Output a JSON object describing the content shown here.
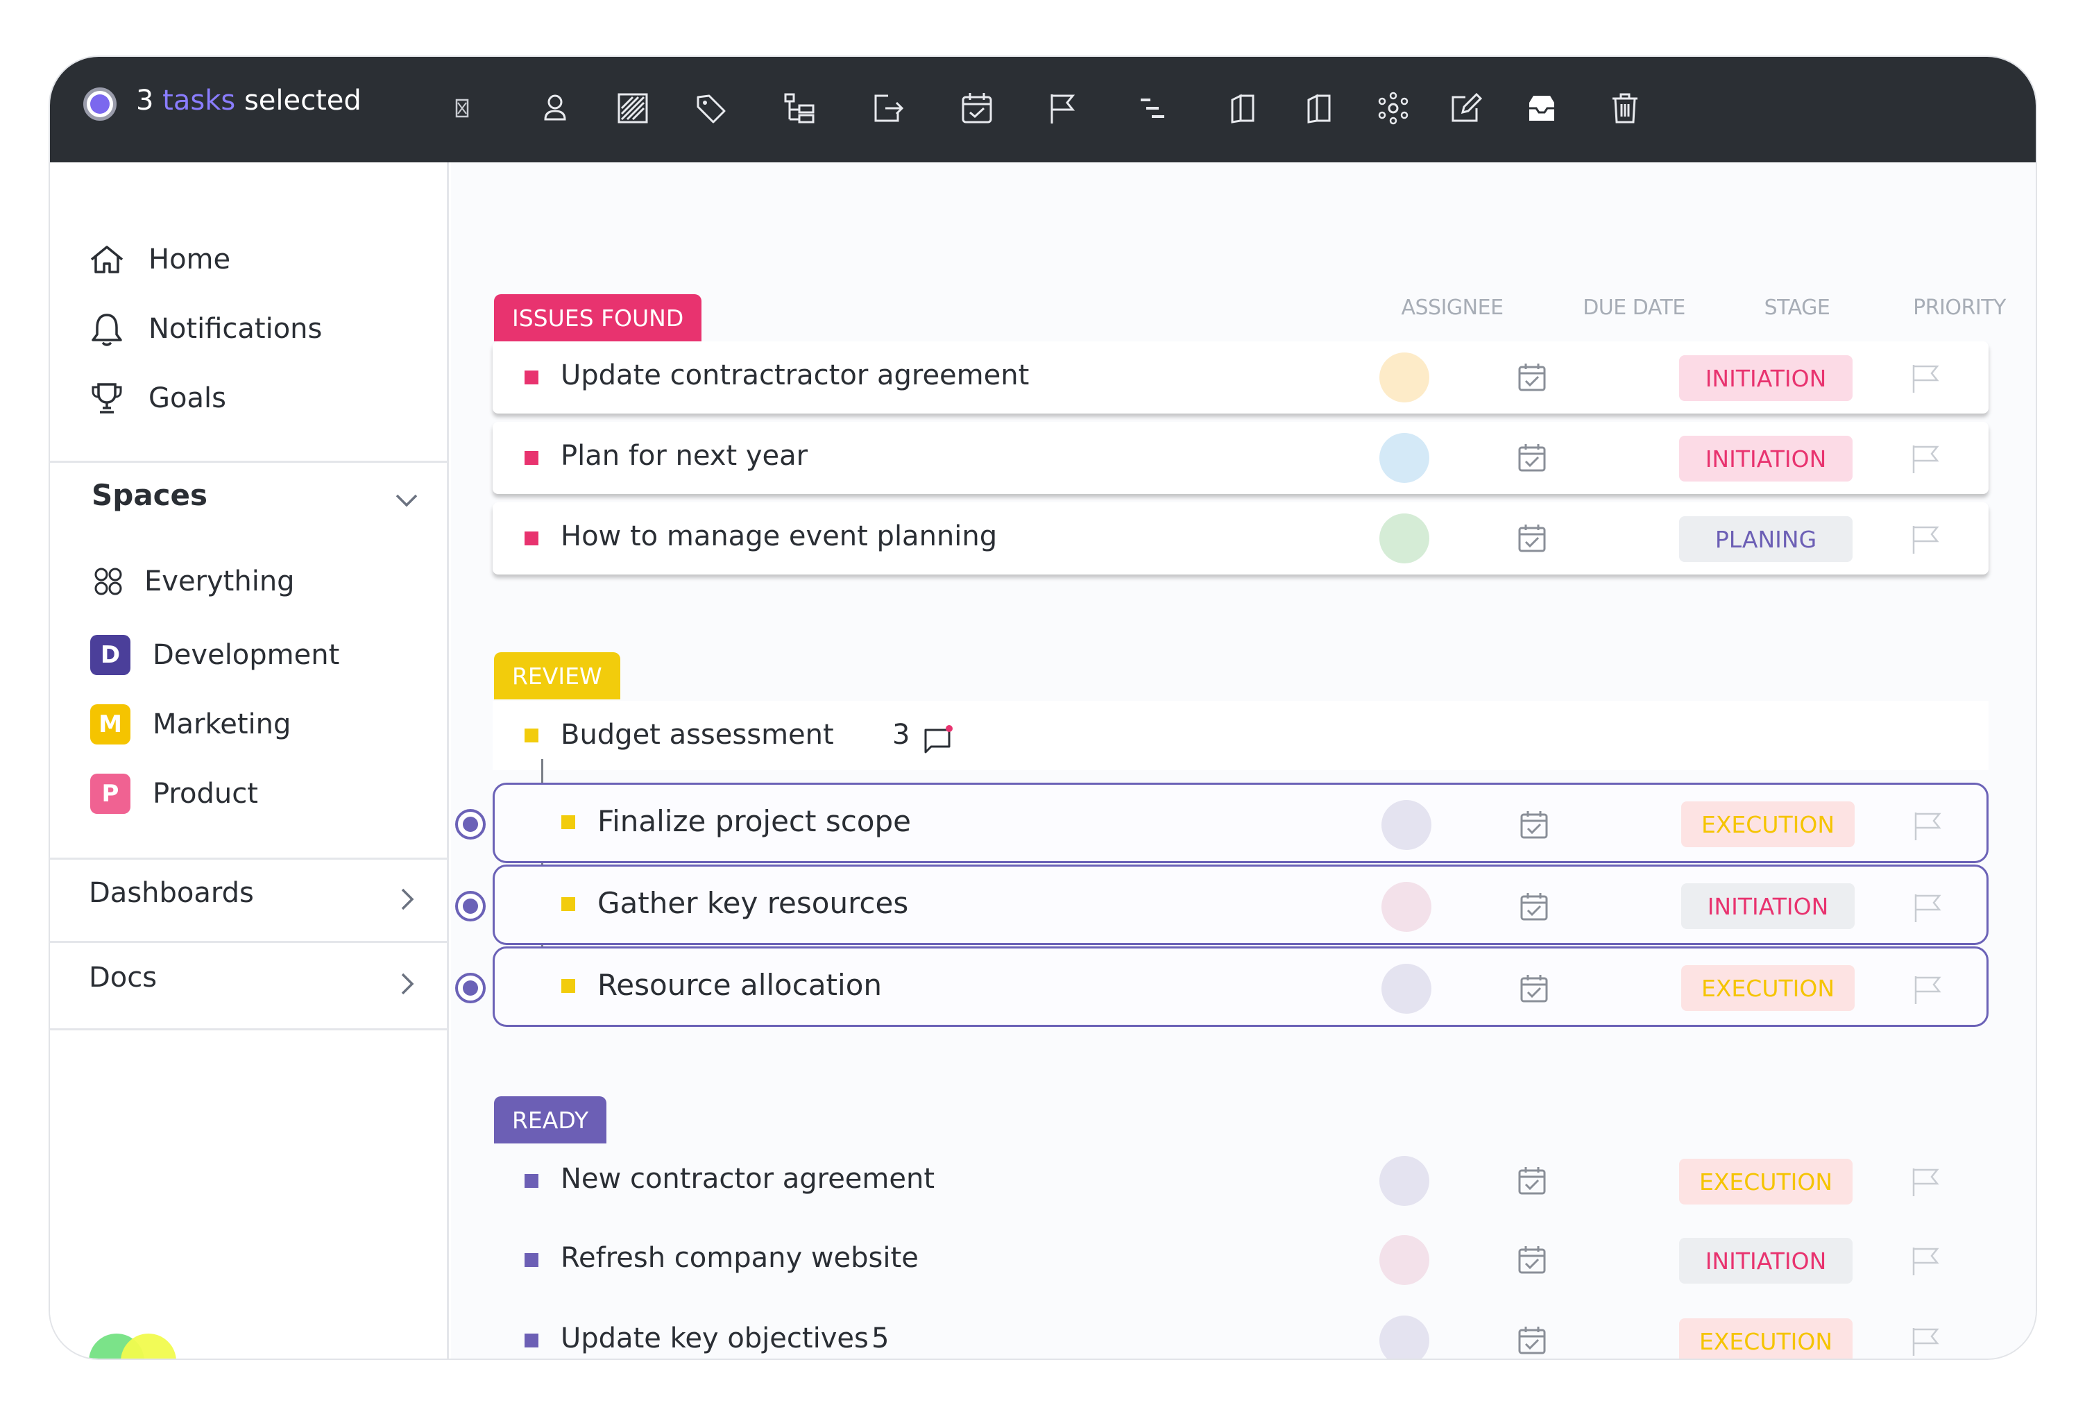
{
  "toolbar": {
    "selected_count": "3",
    "selected_word": "tasks",
    "selected_suffix": "selected",
    "icons": [
      "close-icon",
      "assignee-icon",
      "status-icon",
      "tag-icon",
      "subtask-icon",
      "move-icon",
      "due-date-icon",
      "priority-icon",
      "gantt-icon",
      "copy-icon",
      "duplicate-icon",
      "dependencies-icon",
      "edit-icon",
      "archive-icon",
      "delete-icon"
    ]
  },
  "sidebar": {
    "nav": [
      {
        "label": "Home",
        "icon": "home-icon"
      },
      {
        "label": "Notifications",
        "icon": "bell-icon"
      },
      {
        "label": "Goals",
        "icon": "trophy-icon"
      }
    ],
    "spaces_title": "Spaces",
    "spaces": [
      {
        "label": "Everything",
        "icon": "grid-icon"
      },
      {
        "label": "Development",
        "badge": "D",
        "color": "#4b3f9a"
      },
      {
        "label": "Marketing",
        "badge": "M",
        "color": "#f5c400"
      },
      {
        "label": "Product",
        "badge": "P",
        "color": "#f06292"
      }
    ],
    "dashboards": "Dashboards",
    "docs": "Docs"
  },
  "columns": {
    "assignee": "ASSIGNEE",
    "due_date": "DUE DATE",
    "stage": "STAGE",
    "priority": "PRIORITY"
  },
  "groups": [
    {
      "name": "ISSUES FOUND",
      "color": "#e8336f",
      "tasks": [
        {
          "name": "Update contractractor agreement",
          "stage": "INITIATION",
          "avatar": "#fdebc8"
        },
        {
          "name": "Plan for next year",
          "stage": "INITIATION",
          "avatar": "#d4e9f7"
        },
        {
          "name": "How to manage event planning",
          "stage": "PLANING",
          "avatar": "#d5ecd6"
        }
      ]
    },
    {
      "name": "REVIEW",
      "color": "#f2cc0c",
      "parent": {
        "name": "Budget assessment",
        "comments": "3"
      },
      "tasks": [
        {
          "name": "Finalize project scope",
          "stage": "EXECUTION"
        },
        {
          "name": "Gather key resources",
          "stage": "INITIATION"
        },
        {
          "name": "Resource allocation",
          "stage": "EXECUTION"
        }
      ]
    },
    {
      "name": "READY",
      "color": "#6c5fb5",
      "tasks": [
        {
          "name": "New contractor agreement",
          "stage": "EXECUTION"
        },
        {
          "name": "Refresh company website",
          "stage": "INITIATION"
        },
        {
          "name": "Update key objectives",
          "count": "5",
          "stage": "EXECUTION"
        }
      ]
    }
  ]
}
